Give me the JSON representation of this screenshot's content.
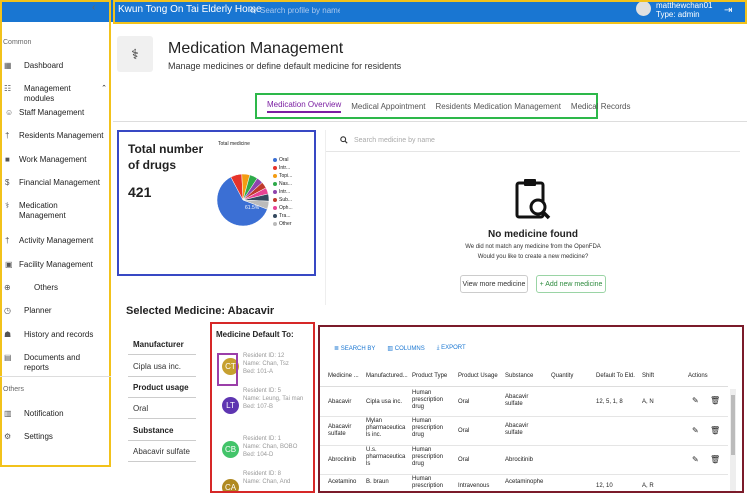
{
  "topbar": {
    "app_title": "Kwun Tong On Tai Elderly Home",
    "search_placeholder": "Search profile by name...",
    "username": "matthewchan01",
    "user_type": "Type: admin"
  },
  "sidebar": {
    "section_common": "Common",
    "section_others": "Others",
    "items": [
      {
        "label": "Dashboard",
        "icon": "dashboard-icon"
      },
      {
        "label": "Management modules",
        "icon": "modules-icon"
      },
      {
        "label": "Staff Management",
        "icon": "staff-icon"
      },
      {
        "label": "Residents Management",
        "icon": "residents-icon"
      },
      {
        "label": "Work Management",
        "icon": "work-icon"
      },
      {
        "label": "Financial Management",
        "icon": "dollar-icon"
      },
      {
        "label": "Medication Management",
        "icon": "medication-icon"
      },
      {
        "label": "Activity Management",
        "icon": "activity-icon"
      },
      {
        "label": "Facility Management",
        "icon": "facility-icon"
      },
      {
        "label": "Others",
        "icon": "plus-circle-icon"
      },
      {
        "label": "Planner",
        "icon": "clock-icon"
      },
      {
        "label": "History and records",
        "icon": "history-icon"
      },
      {
        "label": "Documents and reports",
        "icon": "document-icon"
      },
      {
        "label": "Notification",
        "icon": "notification-icon"
      },
      {
        "label": "Settings",
        "icon": "gear-icon"
      }
    ]
  },
  "header": {
    "title": "Medication Management",
    "subtitle": "Manage medicines or define default medicine for residents"
  },
  "tabs": [
    "Medication Overview",
    "Medical Appointment",
    "Residents Medication Management",
    "Medical Records"
  ],
  "summary": {
    "title": "Total number of drugs",
    "count": "421",
    "chart_title": "Total medicine",
    "pie_label": "61.5%"
  },
  "chart_data": {
    "type": "pie",
    "title": "Total medicine",
    "labels": [
      "Oral",
      "Intr...",
      "Topi...",
      "Nas...",
      "Intr...",
      "Sub...",
      "Oph...",
      "Tra...",
      "Other"
    ],
    "values": [
      61.5,
      7,
      5,
      5,
      4,
      4,
      4,
      4.5,
      5
    ],
    "colors": [
      "#3b6fd4",
      "#e6332a",
      "#f39c12",
      "#2eaa4a",
      "#8e44ad",
      "#c0392b",
      "#e84393",
      "#34495e",
      "#bbbbbb"
    ]
  },
  "search_panel": {
    "placeholder": "Search medicine by name",
    "no_found_title": "No medicine found",
    "no_found_line1": "We did not match any medicine from the OpenFDA",
    "no_found_line2": "Would you like to create a new medicine?",
    "view_more": "View more medicine",
    "add_new": "+ Add new medicine"
  },
  "selected": {
    "title": "Selected Medicine: Abacavir",
    "manufacturer_label": "Manufacturer",
    "manufacturer_value": "Cipla usa inc.",
    "usage_label": "Product usage",
    "usage_value": "Oral",
    "substance_label": "Substance",
    "substance_value": "Abacavir sulfate"
  },
  "default_to": {
    "title": "Medicine Default To:",
    "residents": [
      {
        "initials": "CT",
        "color": "#c6a030",
        "line1": "Resident ID: 12",
        "line2": "Name: Chan, Tsz",
        "line3": "Bed: 101-A"
      },
      {
        "initials": "LT",
        "color": "#5e35b1",
        "line1": "Resident ID: 5",
        "line2": "Name: Leung, Tai man",
        "line3": "Bed: 107-B"
      },
      {
        "initials": "CB",
        "color": "#43c46a",
        "line1": "Resident ID: 1",
        "line2": "Name: Chan, BOBO",
        "line3": "Bed: 104-D"
      },
      {
        "initials": "CA",
        "color": "#b08a22",
        "line1": "Resident ID: 8",
        "line2": "Name: Chan, And",
        "line3": ""
      }
    ]
  },
  "table": {
    "toolbar": [
      "SEARCH BY",
      "COLUMNS",
      "EXPORT"
    ],
    "headers": [
      "Medicine ...",
      "Manufactured...",
      "Product Type",
      "Product Usage",
      "Substance",
      "Quantity",
      "Default To Eld.",
      "Shift",
      "Actions"
    ],
    "rows": [
      [
        "Abacavir",
        "Cipla usa inc.",
        "Human prescription drug",
        "Oral",
        "Abacavir sulfate",
        "",
        "12, 5, 1, 8",
        "A, N"
      ],
      [
        "Abacavir sulfate",
        "Mylan pharmaceutica ls inc.",
        "Human prescription drug",
        "Oral",
        "Abacavir sulfate",
        "",
        "",
        ""
      ],
      [
        "Abrocitinib",
        "U.s. pharmaceutica ls",
        "Human prescription drug",
        "Oral",
        "Abrocitinib",
        "",
        "",
        ""
      ],
      [
        "Acetamino",
        "B. braun",
        "Human prescription",
        "Intravenous",
        "Acetaminophe",
        "",
        "12, 10",
        "A, R"
      ]
    ]
  }
}
